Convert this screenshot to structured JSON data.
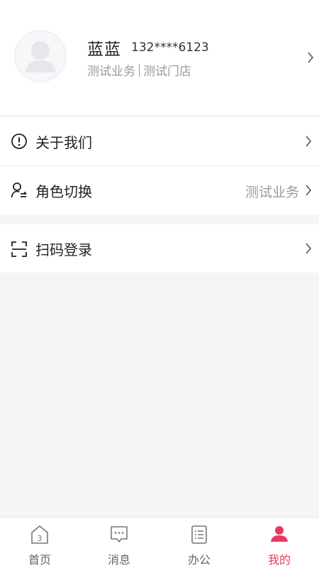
{
  "profile": {
    "name": "蓝蓝",
    "phone": "132****6123",
    "business": "测试业务",
    "store": "测试门店"
  },
  "menu": {
    "about": {
      "label": "关于我们",
      "icon": "info-circle-icon"
    },
    "role_switch": {
      "label": "角色切换",
      "value": "测试业务",
      "icon": "user-switch-icon"
    },
    "scan_login": {
      "label": "扫码登录",
      "icon": "scan-icon"
    }
  },
  "tabs": [
    {
      "label": "首页",
      "icon": "home-icon",
      "active": false
    },
    {
      "label": "消息",
      "icon": "message-icon",
      "active": false
    },
    {
      "label": "办公",
      "icon": "office-list-icon",
      "active": false
    },
    {
      "label": "我的",
      "icon": "person-icon",
      "active": true
    }
  ],
  "colors": {
    "accent": "#e83a62",
    "background": "#f5f5f5",
    "muted_text": "#9a9a9a"
  }
}
